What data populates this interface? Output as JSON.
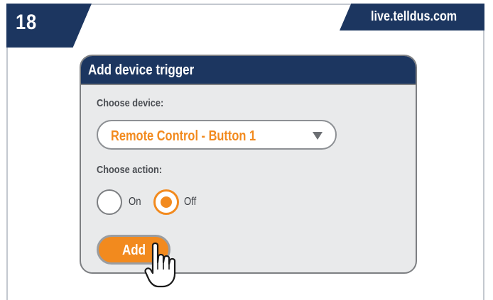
{
  "step": {
    "number": "18"
  },
  "site": {
    "label": "live.telldus.com"
  },
  "dialog": {
    "title": "Add device trigger",
    "device_label": "Choose device:",
    "device_value": "Remote Control - Button 1",
    "action_label": "Choose action:",
    "actions": [
      {
        "label": "On",
        "selected": false
      },
      {
        "label": "Off",
        "selected": true
      }
    ],
    "add_button": "Add"
  },
  "colors": {
    "navy": "#1c3660",
    "accent_orange": "#f28a1e",
    "panel_gray": "#e9eaeb"
  },
  "icons": {
    "cursor": "hand-pointer-icon",
    "dropdown": "caret-down-icon"
  }
}
